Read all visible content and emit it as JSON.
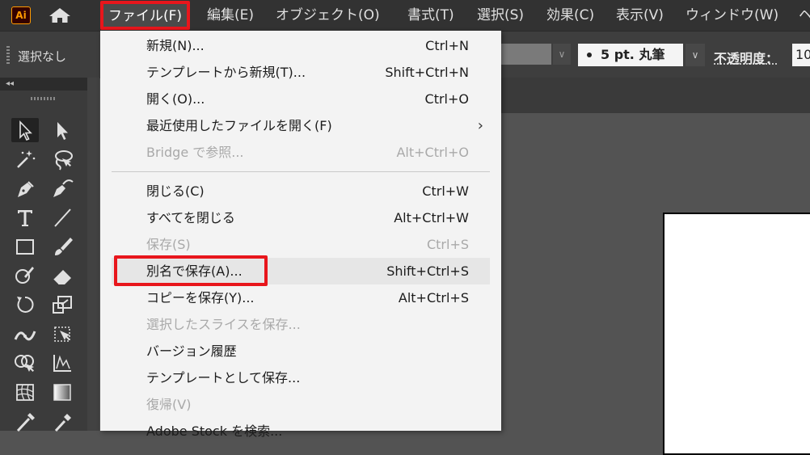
{
  "app": {
    "logo_text": "Ai"
  },
  "menubar": {
    "items": [
      "ファイル(F)",
      "編集(E)",
      "オブジェクト(O)",
      "書式(T)",
      "選択(S)",
      "効果(C)",
      "表示(V)",
      "ウィンドウ(W)",
      "ヘ"
    ]
  },
  "controlbar": {
    "selection": "選択なし",
    "brush": "5 pt. 丸筆",
    "opacity_label": "不透明度：",
    "opacity_value": "10"
  },
  "file_menu": {
    "items": [
      {
        "label": "新規(N)...",
        "shortcut": "Ctrl+N"
      },
      {
        "label": "テンプレートから新規(T)...",
        "shortcut": "Shift+Ctrl+N"
      },
      {
        "label": "開く(O)...",
        "shortcut": "Ctrl+O"
      },
      {
        "label": "最近使用したファイルを開く(F)",
        "shortcut": ""
      },
      {
        "label": "Bridge で参照...",
        "shortcut": "Alt+Ctrl+O"
      },
      {
        "label": "閉じる(C)",
        "shortcut": "Ctrl+W"
      },
      {
        "label": "すべてを閉じる",
        "shortcut": "Alt+Ctrl+W"
      },
      {
        "label": "保存(S)",
        "shortcut": "Ctrl+S"
      },
      {
        "label": "別名で保存(A)...",
        "shortcut": "Shift+Ctrl+S"
      },
      {
        "label": "コピーを保存(Y)...",
        "shortcut": "Alt+Ctrl+S"
      },
      {
        "label": "選択したスライスを保存...",
        "shortcut": ""
      },
      {
        "label": "バージョン履歴",
        "shortcut": ""
      },
      {
        "label": "テンプレートとして保存...",
        "shortcut": ""
      },
      {
        "label": "復帰(V)",
        "shortcut": ""
      },
      {
        "label": "Adobe Stock を検索...",
        "shortcut": ""
      }
    ]
  },
  "colors": {
    "highlight": "#e8161c",
    "menu_bg": "#f3f3f3",
    "app_bg": "#535353"
  }
}
